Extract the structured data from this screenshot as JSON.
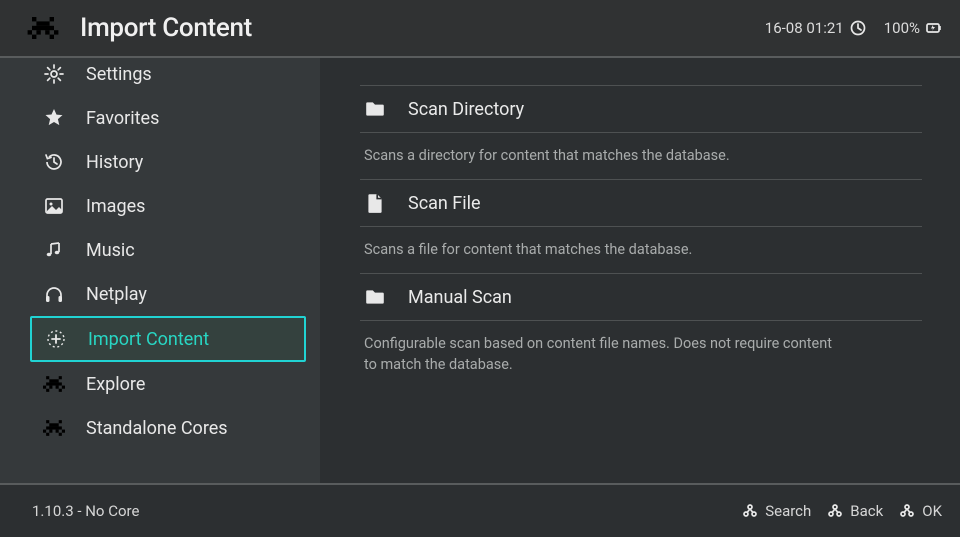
{
  "topbar": {
    "title": "Import Content",
    "datetime": "16-08 01:21",
    "battery_pct": "100%"
  },
  "sidebar": [
    {
      "id": "settings",
      "label": "Settings",
      "icon": "gear-icon"
    },
    {
      "id": "favorites",
      "label": "Favorites",
      "icon": "star-icon"
    },
    {
      "id": "history",
      "label": "History",
      "icon": "history-icon"
    },
    {
      "id": "images",
      "label": "Images",
      "icon": "image-icon"
    },
    {
      "id": "music",
      "label": "Music",
      "icon": "music-icon"
    },
    {
      "id": "netplay",
      "label": "Netplay",
      "icon": "headphones-icon"
    },
    {
      "id": "import-content",
      "label": "Import Content",
      "icon": "plus-circle-icon"
    },
    {
      "id": "explore",
      "label": "Explore",
      "icon": "invader-icon"
    },
    {
      "id": "standalone-cores",
      "label": "Standalone Cores",
      "icon": "invader-icon"
    }
  ],
  "sidebar_selected": "import-content",
  "main": {
    "rows": [
      {
        "id": "scan-directory",
        "label": "Scan Directory",
        "icon": "folder-icon",
        "desc": "Scans a directory for content that matches the database."
      },
      {
        "id": "scan-file",
        "label": "Scan File",
        "icon": "file-icon",
        "desc": "Scans a file for content that matches the database."
      },
      {
        "id": "manual-scan",
        "label": "Manual Scan",
        "icon": "folder-icon",
        "desc": "Configurable scan based on content file names. Does not require content to match the database."
      }
    ]
  },
  "footer": {
    "status": "1.10.3 - No Core",
    "buttons": [
      {
        "id": "search",
        "label": "Search"
      },
      {
        "id": "back",
        "label": "Back"
      },
      {
        "id": "ok",
        "label": "OK"
      }
    ]
  },
  "colors": {
    "accent": "#21d3d3",
    "bg": "#2c2f31",
    "panel": "#35393b"
  }
}
